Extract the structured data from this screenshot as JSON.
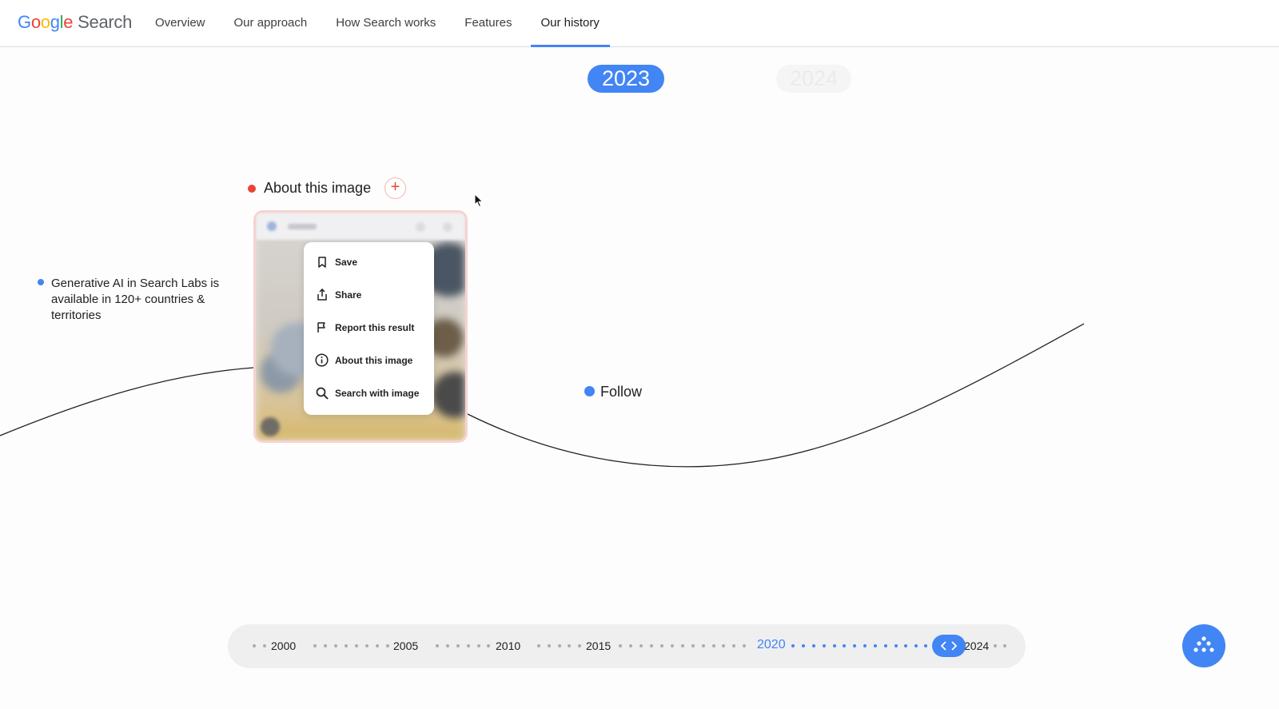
{
  "header": {
    "logo": {
      "letters": [
        "G",
        "o",
        "o",
        "g",
        "l",
        "e"
      ],
      "word": "Search"
    },
    "nav": [
      {
        "label": "Overview",
        "active": false
      },
      {
        "label": "Our approach",
        "active": false
      },
      {
        "label": "How Search works",
        "active": false
      },
      {
        "label": "Features",
        "active": false
      },
      {
        "label": "Our history",
        "active": true
      }
    ]
  },
  "years": {
    "current": "2023",
    "next": "2024"
  },
  "milestones": {
    "ai": {
      "text": "Generative AI in Search Labs is available in 120+ countries & territories",
      "color": "#4285f4"
    },
    "about": {
      "title": "About this image",
      "expand_icon": "plus-icon",
      "color": "#ea4335"
    },
    "follow": {
      "title": "Follow",
      "color": "#4285f4"
    }
  },
  "preview_menu": {
    "items": [
      {
        "label": "Save",
        "icon": "bookmark-icon"
      },
      {
        "label": "Share",
        "icon": "share-icon"
      },
      {
        "label": "Report this result",
        "icon": "flag-icon"
      },
      {
        "label": "About this image",
        "icon": "info-icon"
      },
      {
        "label": "Search with image",
        "icon": "search-icon"
      }
    ]
  },
  "timeline": {
    "labels": [
      {
        "year": "2000",
        "active": false
      },
      {
        "year": "2005",
        "active": false
      },
      {
        "year": "2010",
        "active": false
      },
      {
        "year": "2015",
        "active": false
      },
      {
        "year": "2020",
        "active": true
      },
      {
        "year": "2024",
        "active": false
      }
    ],
    "handle_icon": "chevron-left-right-icon",
    "accent": "#4285f4"
  },
  "fab": {
    "icon": "dots-grid-icon"
  }
}
